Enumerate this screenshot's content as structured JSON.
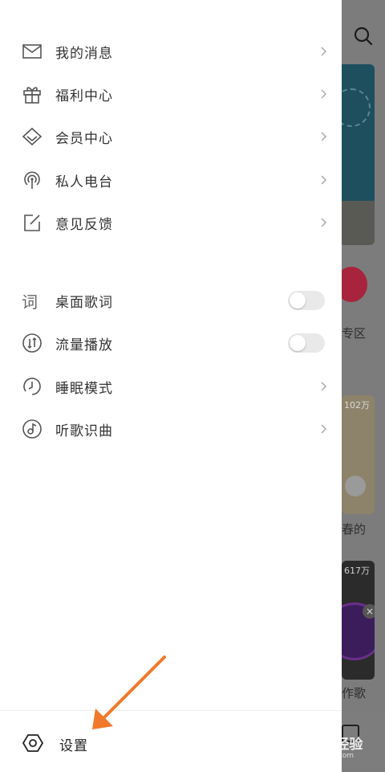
{
  "drawer": {
    "menu_items": [
      {
        "label": "我的消息",
        "icon": "mail-icon"
      },
      {
        "label": "福利中心",
        "icon": "gift-icon"
      },
      {
        "label": "会员中心",
        "icon": "diamond-icon"
      },
      {
        "label": "私人电台",
        "icon": "radio-icon"
      },
      {
        "label": "意见反馈",
        "icon": "feedback-icon"
      }
    ],
    "settings_items": [
      {
        "label": "桌面歌词",
        "icon": "lyrics-icon",
        "control": "toggle",
        "enabled": false,
        "icon_char": "词"
      },
      {
        "label": "流量播放",
        "icon": "data-flow-icon",
        "control": "toggle",
        "enabled": false
      },
      {
        "label": "睡眠模式",
        "icon": "clock-icon",
        "control": "chevron"
      },
      {
        "label": "听歌识曲",
        "icon": "music-recognize-icon",
        "control": "chevron"
      }
    ],
    "settings": {
      "label": "设置",
      "icon": "settings-icon"
    }
  },
  "background": {
    "label_zone": "专区",
    "card1_count": "102万",
    "card1_title": "春的",
    "card2_count": "617万",
    "card2_title": "作歌"
  },
  "watermark": {
    "text": "Bai du 经验",
    "subtext": "jingyan.baidu.com"
  },
  "colors": {
    "drawer_bg": "#ffffff",
    "overlay": "#7b7b7b",
    "arrow": "#f07a2a",
    "toggle_off": "#e9e9e9"
  }
}
